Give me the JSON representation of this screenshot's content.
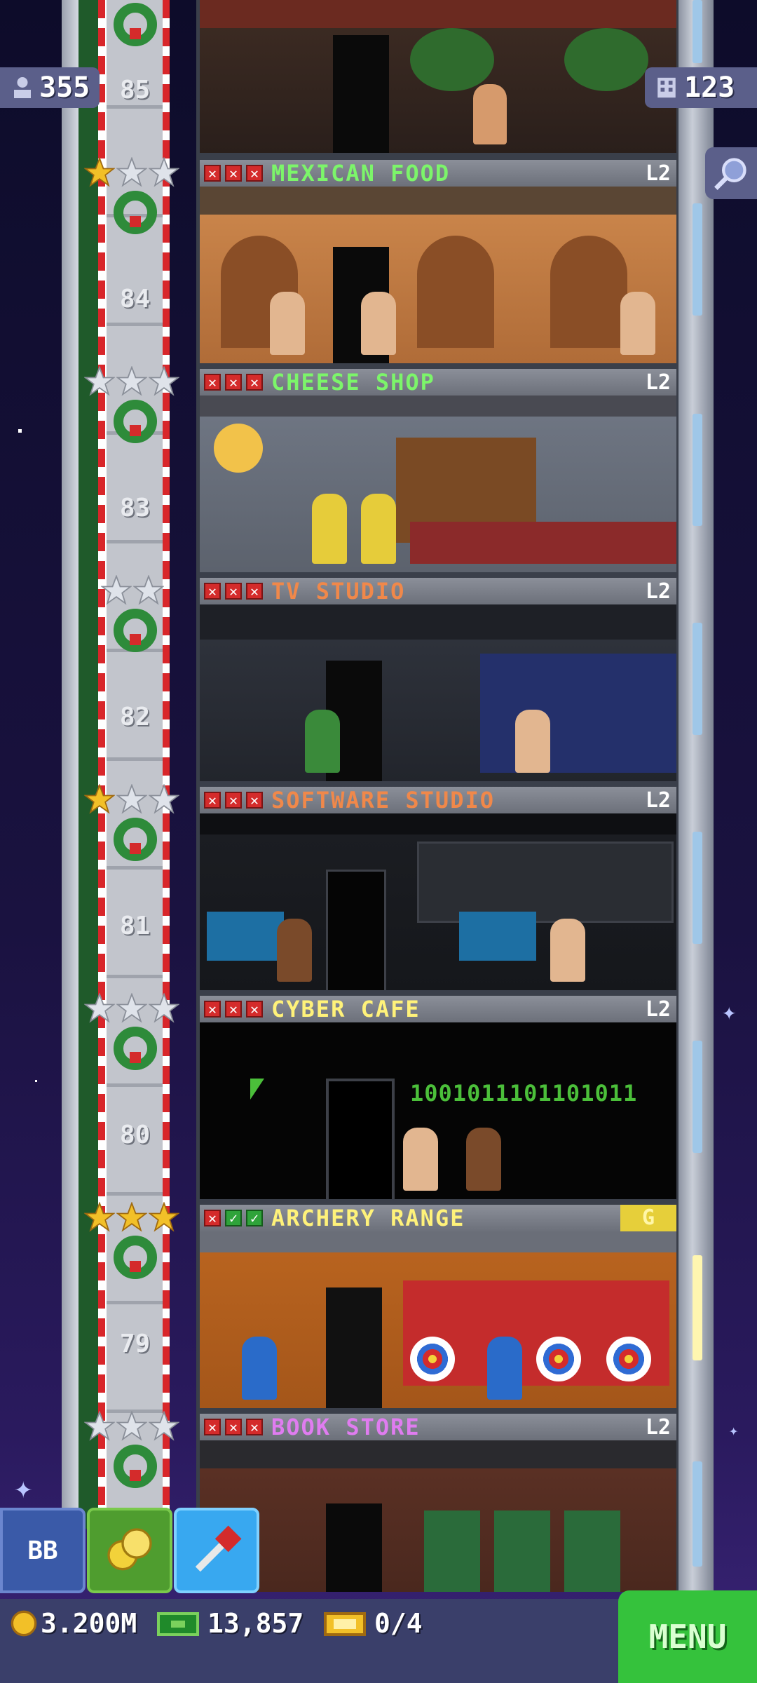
{
  "hud": {
    "population": "355",
    "floors": "123"
  },
  "floors": [
    {
      "number": "85"
    },
    {
      "number": "84"
    },
    {
      "number": "83"
    },
    {
      "number": "82"
    },
    {
      "number": "81"
    },
    {
      "number": "80"
    },
    {
      "number": "79"
    }
  ],
  "rooms": [
    {
      "name": "MEXICAN FOOD",
      "level": "L2",
      "color": "#7cf56a",
      "status": [
        "x",
        "x",
        "x"
      ],
      "stars": [
        "gold",
        "silver",
        "silver"
      ]
    },
    {
      "name": "CHEESE SHOP",
      "level": "L2",
      "color": "#7cf56a",
      "status": [
        "x",
        "x",
        "x"
      ],
      "stars": [
        "silver",
        "silver",
        "silver"
      ]
    },
    {
      "name": "TV STUDIO",
      "level": "L2",
      "color": "#f0884a",
      "status": [
        "x",
        "x",
        "x"
      ],
      "stars": [
        "silver",
        "silver"
      ]
    },
    {
      "name": "SOFTWARE STUDIO",
      "level": "L2",
      "color": "#f0884a",
      "status": [
        "x",
        "x",
        "x"
      ],
      "stars": [
        "gold",
        "silver",
        "silver"
      ]
    },
    {
      "name": "CYBER CAFE",
      "level": "L2",
      "color": "#fff27a",
      "status": [
        "x",
        "x",
        "x"
      ],
      "stars": [
        "silver",
        "silver",
        "silver"
      ]
    },
    {
      "name": "ARCHERY RANGE",
      "level": "G",
      "color": "#fff27a",
      "status": [
        "x",
        "check",
        "check"
      ],
      "stars": [
        "gold",
        "gold",
        "gold"
      ]
    },
    {
      "name": "BOOK STORE",
      "level": "L2",
      "color": "#e07cf0",
      "status": [
        "x",
        "x",
        "x"
      ],
      "stars": [
        "silver",
        "silver",
        "silver"
      ]
    }
  ],
  "cyber_cafe_binary": "1001011101101011",
  "actions": {
    "bb_label": "BB"
  },
  "status_bar": {
    "coins": "3.200M",
    "bux": "13,857",
    "tickets": "0/4",
    "menu_label": "MENU"
  },
  "colors": {
    "menu_green": "#35c23c",
    "bb_blue": "#3a5aa8",
    "coins_green": "#4f9d2f",
    "build_blue": "#38a8f0"
  }
}
